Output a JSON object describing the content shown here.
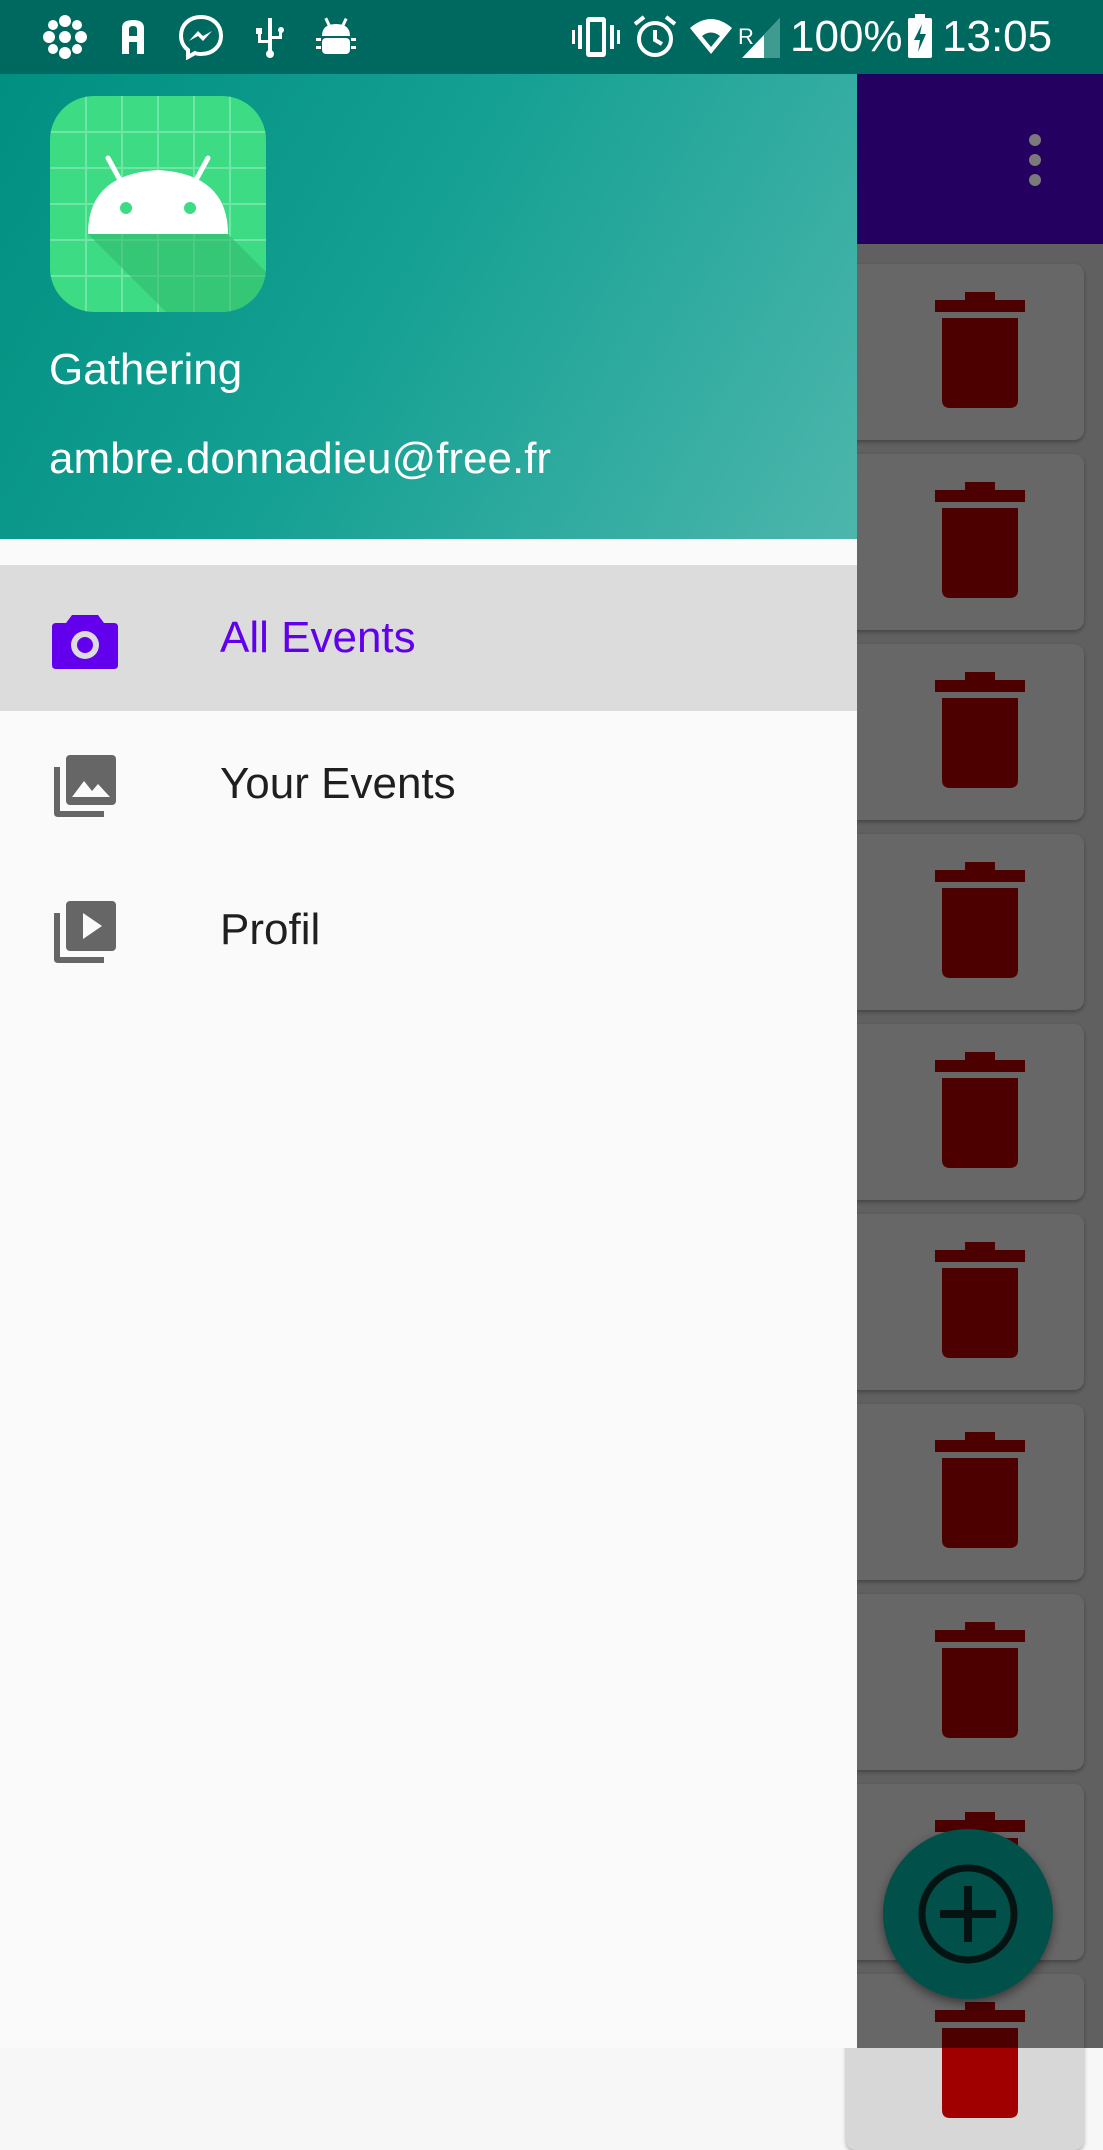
{
  "status_bar": {
    "battery": "100%",
    "time": "13:05",
    "network_label": "R",
    "icons": [
      "cbc-icon",
      "a-icon",
      "messenger-icon",
      "usb-icon",
      "android-debug-icon",
      "vibrate-icon",
      "alarm-icon",
      "wifi-icon",
      "signal-icon",
      "battery-charging-icon"
    ]
  },
  "drawer": {
    "header": {
      "app_name": "Gathering",
      "email": "ambre.donnadieu@free.fr"
    },
    "items": [
      {
        "label": "All Events",
        "icon": "camera-icon",
        "selected": true
      },
      {
        "label": "Your Events",
        "icon": "photo-library-icon",
        "selected": false
      },
      {
        "label": "Profil",
        "icon": "video-library-icon",
        "selected": false
      }
    ]
  },
  "background_app": {
    "toolbar_menu_icon": "overflow-menu-icon",
    "card_icon": "delete-icon",
    "fab_icon": "add-circle-icon"
  },
  "colors": {
    "accent": "#6200ee",
    "header_start": "#008f80",
    "header_end": "#4db6ac",
    "toolbar": "#4c00c9",
    "trash": "#a10000",
    "fab": "#03a89a",
    "status_bar": "#00695f"
  }
}
